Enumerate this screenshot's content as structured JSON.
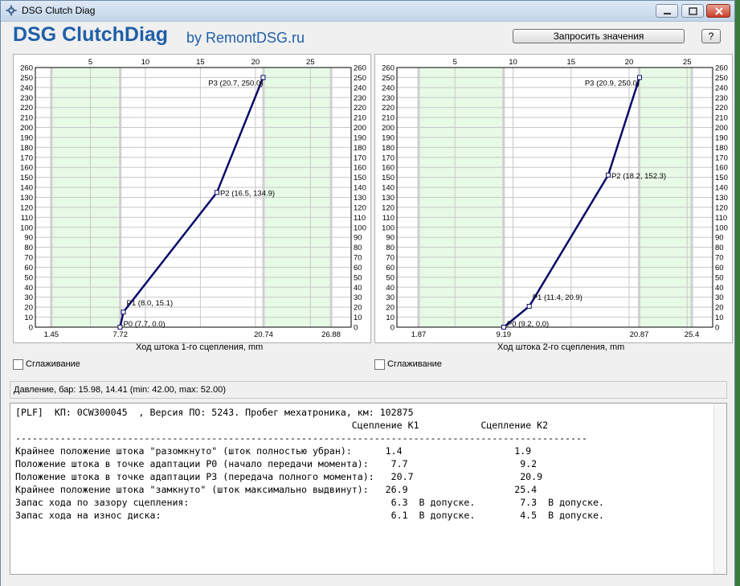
{
  "window": {
    "title": "DSG Clutch Diag",
    "brand": "DSG ClutchDiag",
    "brand_sub": "by RemontDSG.ru",
    "request_button": "Запросить значения",
    "help_button": "?"
  },
  "colors": {
    "zone": "#e6fae6",
    "zone_edge": "#d0d0d0",
    "line": "#0a0a6a",
    "grid": "#c8c8c8",
    "brand": "#1f5fa8"
  },
  "chart_data": [
    {
      "type": "line",
      "xlabel": "Ход штока 1-го сцепления, mm",
      "xlim": [
        0,
        28.7
      ],
      "ylim": [
        0,
        260
      ],
      "grid": true,
      "top_ticks": [
        5,
        10,
        15,
        20,
        25
      ],
      "y_ticks": [
        0,
        10,
        20,
        30,
        40,
        50,
        60,
        70,
        80,
        90,
        100,
        110,
        120,
        130,
        140,
        150,
        160,
        170,
        180,
        190,
        200,
        210,
        220,
        230,
        240,
        250,
        260
      ],
      "bottom_ticks": [
        {
          "x": 1.45,
          "label": "1.45"
        },
        {
          "x": 7.72,
          "label": "7.72"
        },
        {
          "x": 20.74,
          "label": "20.74"
        },
        {
          "x": 26.88,
          "label": "26.88"
        }
      ],
      "zones": [
        [
          1.45,
          7.72
        ],
        [
          20.74,
          26.88
        ]
      ],
      "points": [
        {
          "x": 7.7,
          "y": 0.0,
          "label": "P0 (7.7, 0.0)"
        },
        {
          "x": 8.0,
          "y": 15.1,
          "label": "P1 (8.0, 15.1)"
        },
        {
          "x": 16.5,
          "y": 134.9,
          "label": "P2 (16.5, 134.9)"
        },
        {
          "x": 20.7,
          "y": 250.0,
          "label": "P3 (20.7, 250.0)"
        }
      ]
    },
    {
      "type": "line",
      "xlabel": "Ход штока 2-го сцепления, mm",
      "xlim": [
        0,
        27.2
      ],
      "ylim": [
        0,
        260
      ],
      "grid": true,
      "top_ticks": [
        5,
        10,
        15,
        20,
        25
      ],
      "y_ticks": [
        0,
        10,
        20,
        30,
        40,
        50,
        60,
        70,
        80,
        90,
        100,
        110,
        120,
        130,
        140,
        150,
        160,
        170,
        180,
        190,
        200,
        210,
        220,
        230,
        240,
        250,
        260
      ],
      "bottom_ticks": [
        {
          "x": 1.87,
          "label": "1.87"
        },
        {
          "x": 9.19,
          "label": "9.19"
        },
        {
          "x": 20.87,
          "label": "20.87"
        },
        {
          "x": 25.4,
          "label": "25.4"
        }
      ],
      "zones": [
        [
          1.87,
          9.19
        ],
        [
          20.87,
          25.4
        ]
      ],
      "points": [
        {
          "x": 9.2,
          "y": 0.0,
          "label": "P0 (9.2, 0.0)"
        },
        {
          "x": 11.4,
          "y": 20.9,
          "label": "P1 (11.4, 20.9)"
        },
        {
          "x": 18.2,
          "y": 152.3,
          "label": "P2 (18.2, 152.3)"
        },
        {
          "x": 20.9,
          "y": 250.0,
          "label": "P3 (20.9, 250.0)"
        }
      ]
    }
  ],
  "smoothing": {
    "label1": "Сглаживание",
    "label2": "Сглаживание"
  },
  "pressure": "Давление, бар: 15.98, 14.41 (min: 42.00, max: 52.00)",
  "report": [
    "[PLF]  КП: 0CW300045  , Версия ПО: 5243. Пробег мехатроника, км: 102875",
    "                                                            Сцепление K1           Сцепление K2",
    "------------------------------------------------------------------------------------------------------",
    "Крайнее положение штока \"разомкнуто\" (шток полностью убран):      1.4                    1.9",
    "Положение штока в точке адаптации P0 (начало передачи момента):    7.7                    9.2",
    "Положение штока в точке адаптации P3 (передача полного момента):   20.7                   20.9",
    "Крайнее положение штока \"замкнуто\" (шток максимально выдвинут):   26.9                   25.4",
    "Запас хода по зазору сцепления:                                    6.3  В допуске.        7.3  В допуске.",
    "Запас хода на износ диска:                                         6.1  В допуске.        4.5  В допуске."
  ]
}
